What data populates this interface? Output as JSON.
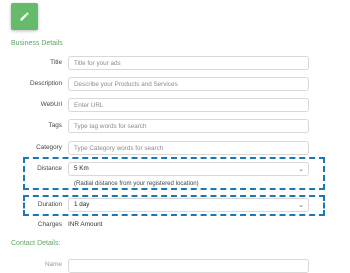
{
  "colors": {
    "accent": "#66bb6a",
    "section": "#5fa460",
    "highlight": "#1a78b4"
  },
  "edit_icon": "pencil-icon",
  "business_section": {
    "title": "Business Details"
  },
  "fields": {
    "title": {
      "label": "Title",
      "placeholder": "Title for your ads"
    },
    "description": {
      "label": "Description",
      "placeholder": "Describe your Products and Services"
    },
    "weburl": {
      "label": "WebUrl",
      "placeholder": "Enter URL"
    },
    "tags": {
      "label": "Tags",
      "placeholder": "Type tag words for search"
    },
    "category": {
      "label": "Category",
      "placeholder": "Type Category words for search"
    },
    "distance": {
      "label": "Distance",
      "value": "5 Km",
      "hint": "(Radial distance from your registered location)"
    },
    "duration": {
      "label": "Duration",
      "value": "1 day"
    },
    "charges": {
      "label": "Charges",
      "value": "INR Amount"
    }
  },
  "contact_section": {
    "title": "Contact Details:"
  },
  "name_field": {
    "label": "Name"
  }
}
